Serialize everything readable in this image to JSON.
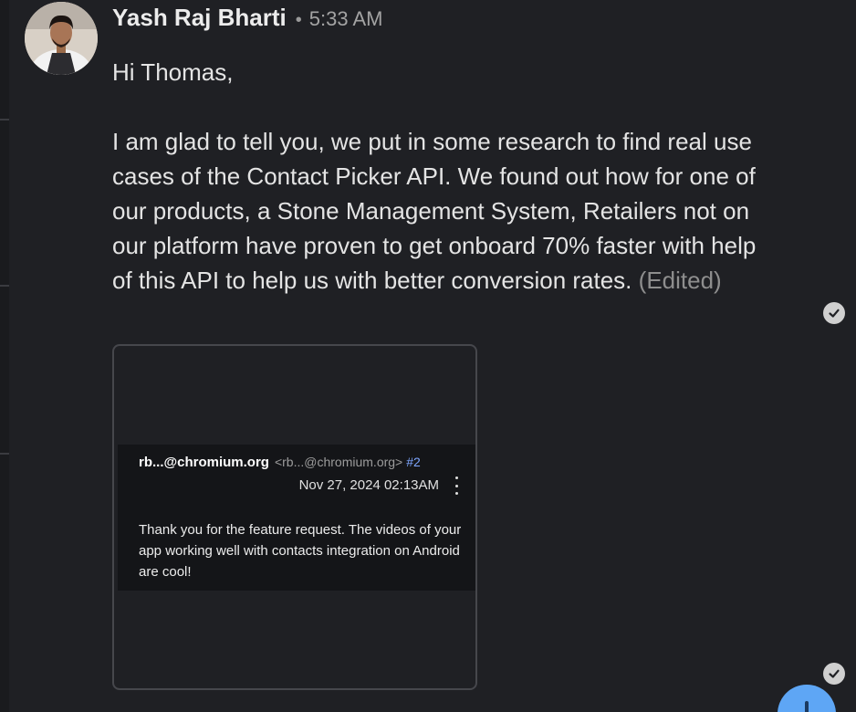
{
  "message": {
    "sender": "Yash Raj Bharti",
    "separator": "•",
    "time": "5:33 AM",
    "greeting": "Hi Thomas,",
    "body": "I am glad to tell you, we put in some research to find real use cases of the Contact Picker API. We found out how for one of our products, a Stone Management System, Retailers not on our platform have proven to get onboard 70% faster with help of this API to help us with better conversion rates.",
    "edited_label": "(Edited)"
  },
  "attachment": {
    "from": "rb...@chromium.org",
    "address": "<rb...@chromium.org>",
    "comment_number": "#2",
    "date": "Nov 27, 2024 02:13AM",
    "body": "Thank you for the feature request. The videos of your app working well with contacts integration on Android are cool!"
  },
  "icons": {
    "read_receipt": "check-circle-icon",
    "more": "more-vertical-icon",
    "fab": "add-icon"
  },
  "colors": {
    "background": "#1f2024",
    "fab": "#5ea6f5",
    "link": "#7ea6ff"
  }
}
